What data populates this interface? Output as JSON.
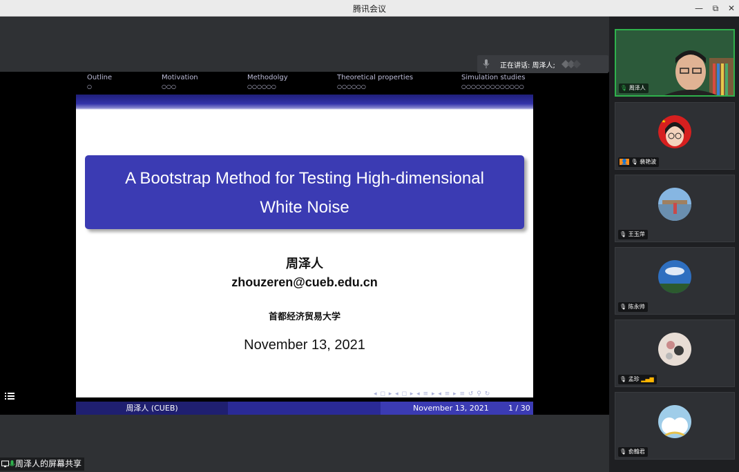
{
  "window": {
    "title": "腾讯会议",
    "controls": {
      "min": "—",
      "max": "⧉",
      "close": "✕"
    }
  },
  "speaking": {
    "label": "正在讲话: 周泽人;"
  },
  "slide": {
    "nav": [
      {
        "label": "Outline",
        "dots": "○"
      },
      {
        "label": "Motivation",
        "dots": "○○○"
      },
      {
        "label": "Methodolgy",
        "dots": "○○○○○○"
      },
      {
        "label": "Theoretical properties",
        "dots": "○○○○○○"
      },
      {
        "label": "Simulation studies",
        "dots": "○○○○○○○○○○○○○"
      }
    ],
    "title_line1": "A Bootstrap Method for Testing High-dimensional",
    "title_line2": "White Noise",
    "author": "周泽人",
    "email": "zhouzeren@cueb.edu.cn",
    "institution": "首都经济贸易大学",
    "date": "November 13, 2021",
    "beamer_nav": "◂ ◻ ▸ ◂ ◻ ▸ ◂ ≡ ▸ ◂ ≡ ▸  ≡  ↺ ⚲ ↻",
    "footer": {
      "left": "周泽人 (CUEB)",
      "date": "November 13, 2021",
      "page": "1 / 30"
    }
  },
  "share_label": "周泽人的屏幕共享",
  "participants": [
    {
      "name": "周泽人",
      "active": true,
      "color": "#2fb24c"
    },
    {
      "name": "裴艳波",
      "active": false,
      "color": "#ff8c1a"
    },
    {
      "name": "王玉萍",
      "active": false
    },
    {
      "name": "陈永帅",
      "active": false
    },
    {
      "name": "孟珍",
      "active": false
    },
    {
      "name": "俞翰君",
      "active": false
    }
  ]
}
